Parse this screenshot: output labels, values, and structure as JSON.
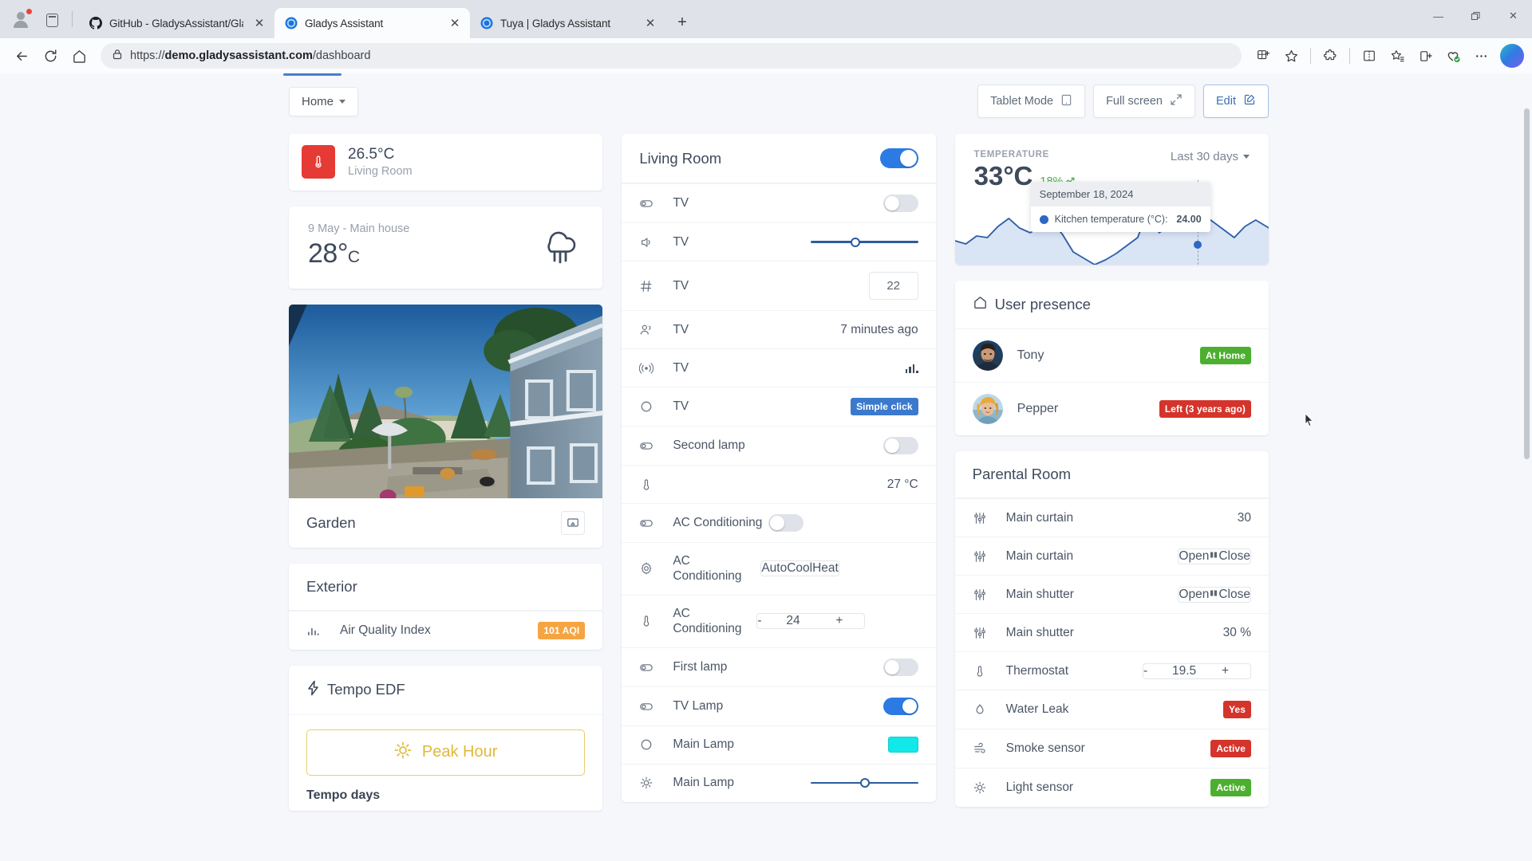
{
  "browser": {
    "tabs": [
      {
        "title": "GitHub - GladysAssistant/Gladys",
        "favicon": "github-icon",
        "active": false
      },
      {
        "title": "Gladys Assistant",
        "favicon": "gladys-icon",
        "active": true
      },
      {
        "title": "Tuya | Gladys Assistant",
        "favicon": "gladys-icon",
        "active": false
      }
    ],
    "new_tab_label": "+",
    "window_controls": {
      "minimize": "—",
      "maximize": "❐",
      "close": "✕"
    },
    "url_prefix": "https://",
    "url_domain": "demo.gladysassistant.com",
    "url_path": "/dashboard",
    "nav": {
      "back": "←",
      "reload": "↻",
      "home": "home-icon"
    },
    "right_icons": [
      "collections-icon",
      "favorite-star-icon",
      "extensions-icon",
      "split-screen-icon",
      "favorites-list-icon",
      "add-collection-icon",
      "browser-essentials-icon",
      "settings-more-icon",
      "copilot-icon"
    ]
  },
  "header": {
    "home_selector": "Home",
    "tablet_mode": "Tablet Mode",
    "full_screen": "Full screen",
    "edit": "Edit"
  },
  "left_column": {
    "temperature_tile": {
      "value": "26.5°C",
      "room": "Living Room",
      "icon": "thermometer-icon",
      "color": "#e63a34"
    },
    "weather": {
      "subtitle": "9 May - Main house",
      "temp": "28°",
      "unit": "C",
      "icon": "rain-cloud-icon"
    },
    "camera": {
      "name": "Garden",
      "cast_icon": "cast-icon"
    },
    "exterior": {
      "title": "Exterior",
      "rows": [
        {
          "icon": "bar-chart-icon",
          "label": "Air Quality Index",
          "badge": "101 AQI",
          "badge_color": "orange"
        }
      ]
    },
    "tempo": {
      "title": "Tempo EDF",
      "icon": "lightning-icon",
      "peak_label": "Peak Hour",
      "peak_icon": "sun-icon",
      "days_label": "Tempo days"
    }
  },
  "middle_column": {
    "title": "Living Room",
    "master_toggle": "on",
    "rows": [
      {
        "icon": "toggle-device-icon",
        "label": "TV",
        "control": "toggle",
        "state": "off"
      },
      {
        "icon": "volume-icon",
        "label": "TV",
        "control": "slider",
        "value": 38
      },
      {
        "icon": "hash-icon",
        "label": "TV",
        "control": "numbox",
        "value": "22"
      },
      {
        "icon": "people-icon",
        "label": "TV",
        "control": "text",
        "value": "7 minutes ago"
      },
      {
        "icon": "broadcast-icon",
        "label": "TV",
        "control": "signal"
      },
      {
        "icon": "circle-icon",
        "label": "TV",
        "control": "badge",
        "value": "Simple click",
        "badge_color": "blue"
      },
      {
        "icon": "toggle-device-icon",
        "label": "Second lamp",
        "control": "toggle",
        "state": "off"
      },
      {
        "icon": "thermometer-icon",
        "label": "",
        "control": "text",
        "value": "27 °C"
      },
      {
        "icon": "toggle-device-icon",
        "label": "AC Conditioning",
        "control": "toggle",
        "state": "off"
      },
      {
        "icon": "gear-icon",
        "label": "AC Conditioning",
        "control": "segmented",
        "options": [
          "Auto",
          "Cool",
          "Heat"
        ],
        "selected": "Cool"
      },
      {
        "icon": "thermometer-icon",
        "label": "AC Conditioning",
        "control": "stepper",
        "minus": "-",
        "value": "24",
        "plus": "+"
      },
      {
        "icon": "toggle-device-icon",
        "label": "First lamp",
        "control": "toggle",
        "state": "off"
      },
      {
        "icon": "toggle-device-icon",
        "label": "TV Lamp",
        "control": "toggle",
        "state": "on"
      },
      {
        "icon": "circle-icon",
        "label": "Main Lamp",
        "control": "color",
        "value": "#12e8e8"
      },
      {
        "icon": "brightness-icon",
        "label": "Main Lamp",
        "control": "slider",
        "value": 48
      }
    ]
  },
  "right_column": {
    "chart_card": {
      "kicker": "TEMPERATURE",
      "value": "33°C",
      "delta": "18%",
      "delta_icon": "trend-up-icon",
      "range_label": "Last 30 days",
      "tooltip": {
        "date": "September 18, 2024",
        "series_label": "Kitchen temperature (°C):",
        "series_value": "24.00"
      }
    },
    "user_presence": {
      "title": "User presence",
      "icon": "home-icon",
      "users": [
        {
          "name": "Tony",
          "status": "At Home",
          "status_color": "green",
          "avatar": "tony-avatar"
        },
        {
          "name": "Pepper",
          "status": "Left (3 years ago)",
          "status_color": "red",
          "avatar": "pepper-avatar"
        }
      ]
    },
    "parental_room": {
      "title": "Parental Room",
      "rows": [
        {
          "icon": "sliders-icon",
          "label": "Main curtain",
          "control": "text",
          "value": "30"
        },
        {
          "icon": "sliders-icon",
          "label": "Main curtain",
          "control": "segmented3",
          "options": [
            "Open",
            "‖",
            "Close"
          ],
          "selected": "Open"
        },
        {
          "icon": "sliders-icon",
          "label": "Main shutter",
          "control": "segmented3",
          "options": [
            "Open",
            "‖",
            "Close"
          ],
          "selected": "Open"
        },
        {
          "icon": "sliders-icon",
          "label": "Main shutter",
          "control": "text",
          "value": "30 %"
        },
        {
          "icon": "thermometer-icon",
          "label": "Thermostat",
          "control": "stepper",
          "minus": "-",
          "value": "19.5",
          "plus": "+"
        },
        {
          "icon": "water-drop-icon",
          "label": "Water Leak",
          "control": "badge",
          "value": "Yes",
          "badge_color": "red"
        },
        {
          "icon": "wind-icon",
          "label": "Smoke sensor",
          "control": "badge",
          "value": "Active",
          "badge_color": "red"
        },
        {
          "icon": "brightness-icon",
          "label": "Light sensor",
          "control": "badge",
          "value": "Active",
          "badge_color": "green"
        }
      ]
    }
  },
  "chart_data": {
    "type": "area",
    "title": "TEMPERATURE",
    "series": [
      {
        "name": "Kitchen temperature (°C)",
        "values": [
          20.5,
          20.0,
          21.5,
          20.8,
          22.0,
          24.5,
          23.2,
          22.6,
          23.4,
          24.0,
          22.0,
          19.0,
          17.5,
          16.0,
          17.0,
          18.0,
          19.0,
          20.5,
          24.0,
          21.0,
          22.0,
          21.2,
          22.5,
          24.0,
          23.0,
          22.0,
          21.0,
          22.5,
          23.5,
          22.8
        ]
      }
    ],
    "highlight": {
      "x_label": "September 18, 2024",
      "y_value": 24.0
    },
    "current_value": 33,
    "delta_percent": 18,
    "range": "Last 30 days",
    "xlabel": "",
    "ylabel": "",
    "grid": false,
    "legend": "none"
  }
}
